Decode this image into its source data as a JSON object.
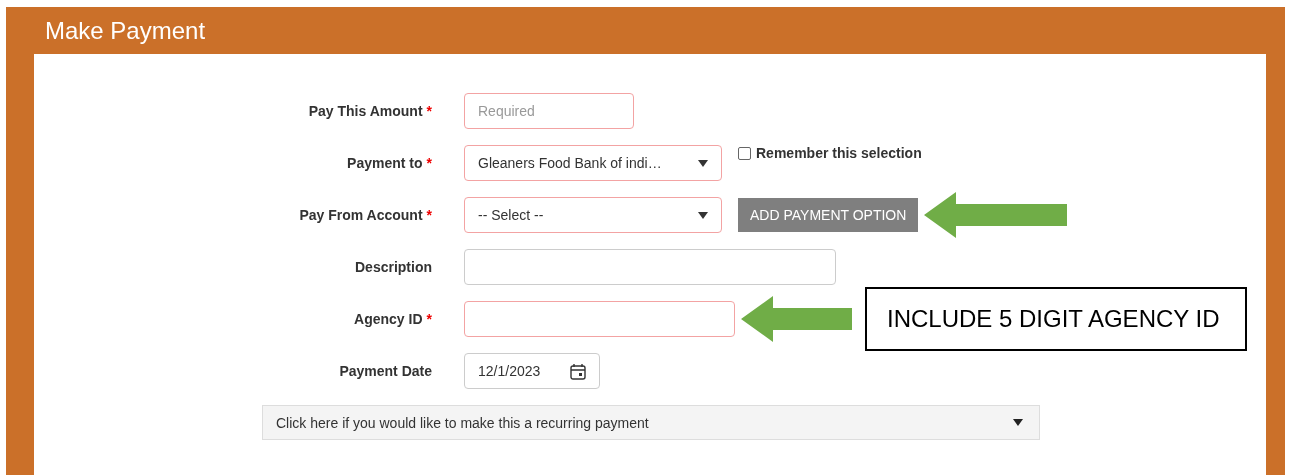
{
  "header": {
    "title": "Make Payment"
  },
  "fields": [
    {
      "label": "Pay This Amount",
      "required_mark": "*",
      "kind": "text",
      "placeholder": "Required",
      "invalid": true
    },
    {
      "label": "Payment to",
      "required_mark": "*",
      "kind": "select",
      "value": "Gleaners Food Bank of indi…",
      "invalid": true,
      "checkbox": {
        "label": "Remember this selection",
        "checked": false
      }
    },
    {
      "label": "Pay From Account",
      "required_mark": "*",
      "kind": "select",
      "value": "-- Select --",
      "invalid": true,
      "button": {
        "label": "ADD PAYMENT OPTION"
      },
      "arrow": true
    },
    {
      "label": "Description",
      "kind": "text",
      "invalid": false
    },
    {
      "label": "Agency ID",
      "required_mark": "*",
      "kind": "text",
      "invalid": true,
      "arrow": true,
      "note": "INCLUDE 5 DIGIT AGENCY ID"
    },
    {
      "label": "Payment Date",
      "kind": "date",
      "value": "12/1/2023",
      "invalid": false
    }
  ],
  "recurring": {
    "label": "Click here if you would like to make this a recurring payment",
    "expanded": false
  }
}
